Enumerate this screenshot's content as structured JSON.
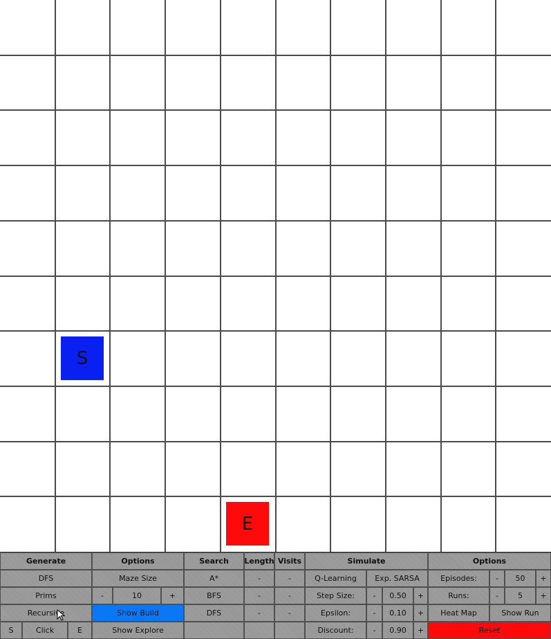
{
  "colors": {
    "start": "#0a1ff2",
    "end": "#ff0a0a",
    "show_build": "#0a78f5",
    "reset": "#ff0a0a",
    "panel": "#9a9a9a"
  },
  "maze": {
    "cols": 10,
    "rows": 10,
    "start": {
      "label": "S",
      "col": 1,
      "row": 6
    },
    "end": {
      "label": "E",
      "col": 4,
      "row": 9
    }
  },
  "panel": {
    "generate": {
      "header": "Generate",
      "dfs": "DFS",
      "prims": "Prims",
      "recursive": "Recursive",
      "start_label": "S",
      "click": "Click",
      "end_label": "E"
    },
    "options": {
      "header": "Options",
      "maze_size": "Maze Size",
      "minus": "-",
      "size_value": "10",
      "plus": "+",
      "show_build": "Show Build",
      "show_explore": "Show Explore"
    },
    "search": {
      "header": "Search",
      "length_header": "Length",
      "visits_header": "Visits",
      "rows": [
        {
          "name": "A*",
          "length": "-",
          "visits": "-"
        },
        {
          "name": "BFS",
          "length": "-",
          "visits": "-"
        },
        {
          "name": "DFS",
          "length": "-",
          "visits": "-"
        }
      ]
    },
    "simulate": {
      "header": "Simulate",
      "q_learning": "Q-Learning",
      "exp_sarsa": "Exp. SARSA",
      "step_size": {
        "label": "Step Size:",
        "minus": "-",
        "value": "0.50",
        "plus": "+"
      },
      "epsilon": {
        "label": "Epsilon:",
        "minus": "-",
        "value": "0.10",
        "plus": "+"
      },
      "discount": {
        "label": "Discount:",
        "minus": "-",
        "value": "0.90",
        "plus": "+"
      }
    },
    "options2": {
      "header": "Options",
      "episodes": {
        "label": "Episodes:",
        "minus": "-",
        "value": "50",
        "plus": "+"
      },
      "runs": {
        "label": "Runs:",
        "minus": "-",
        "value": "5",
        "plus": "+"
      },
      "heat_map": "Heat Map",
      "show_run": "Show Run",
      "reset": "Reset"
    }
  }
}
